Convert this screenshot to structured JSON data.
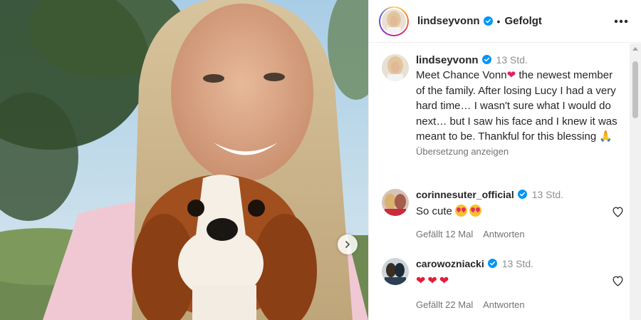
{
  "post": {
    "author": "lindseyvonn",
    "follow_state": "Gefolgt",
    "separator": "•",
    "caption_time": "13 Std.",
    "caption_text_a": "Meet Chance Vonn",
    "caption_text_b": " the newest member of the family.  After losing Lucy I had a very hard time… I wasn't sure what I would do next… but I saw his face and I knew it was meant to be. Thankful for this blessing ",
    "translate_label": "Übersetzung anzeigen"
  },
  "comments": [
    {
      "user": "corinnesuter_official",
      "time": "13 Std.",
      "text": "So cute",
      "likes": "Gefällt 12 Mal",
      "reply": "Antworten"
    },
    {
      "user": "carowozniacki",
      "time": "13 Std.",
      "text": "",
      "likes": "Gefällt 22 Mal",
      "reply": "Antworten"
    }
  ],
  "icons": {
    "verified": "verified-badge-icon",
    "more": "more-options-icon",
    "like": "heart-outline-icon",
    "next": "chevron-right-icon"
  },
  "colors": {
    "verified_blue": "#0095f6",
    "text": "#262626",
    "secondary": "#8e8e8e"
  }
}
